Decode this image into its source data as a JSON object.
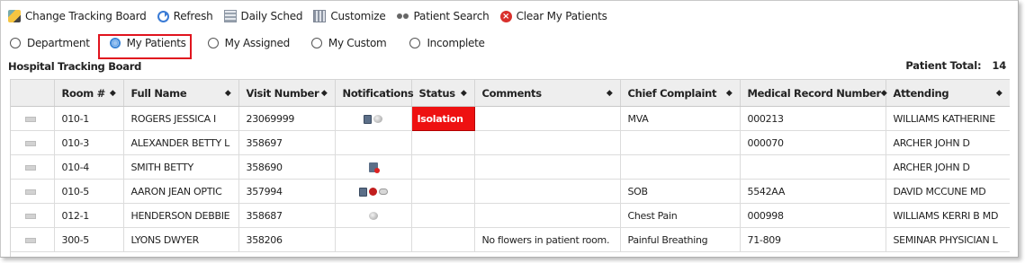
{
  "toolbar": {
    "items": [
      {
        "label": "Change Tracking Board",
        "icon": "pencil-icon"
      },
      {
        "label": "Refresh",
        "icon": "refresh-icon"
      },
      {
        "label": "Daily Sched",
        "icon": "calendar-icon"
      },
      {
        "label": "Customize",
        "icon": "columns-icon"
      },
      {
        "label": "Patient Search",
        "icon": "binoculars-icon"
      },
      {
        "label": "Clear My Patients",
        "icon": "clear-icon"
      }
    ]
  },
  "filters": {
    "options": [
      "Department",
      "My Patients",
      "My Assigned",
      "My Custom",
      "Incomplete"
    ],
    "selected": "My Patients",
    "highlight_color": "#e0141e"
  },
  "board": {
    "title": "Hospital Tracking Board",
    "total_label": "Patient Total:",
    "total_value": "14"
  },
  "table": {
    "columns": [
      "",
      "Room #",
      "Full Name",
      "Visit Number",
      "Notifications",
      "Status",
      "Comments",
      "Chief Complaint",
      "Medical Record Number",
      "Attending"
    ],
    "rows": [
      {
        "room": "010-1",
        "name": "ROGERS JESSICA I",
        "visit": "23069999",
        "notifications": [
          "doc-icon",
          "pill-icon"
        ],
        "status": "Isolation",
        "comments": "",
        "complaint": "MVA",
        "mrn": "000213",
        "attending": "WILLIAMS KATHERINE"
      },
      {
        "room": "010-3",
        "name": "ALEXANDER BETTY L",
        "visit": "358697",
        "notifications": [],
        "status": "",
        "comments": "",
        "complaint": "",
        "mrn": "000070",
        "attending": "ARCHER JOHN D"
      },
      {
        "room": "010-4",
        "name": "SMITH BETTY",
        "visit": "358690",
        "notifications": [
          "flag-alert-icon"
        ],
        "status": "",
        "comments": "",
        "complaint": "",
        "mrn": "",
        "attending": "ARCHER JOHN D"
      },
      {
        "room": "010-5",
        "name": "AARON JEAN OPTIC",
        "visit": "357994",
        "notifications": [
          "doc-icon",
          "alert-icon",
          "cloud-icon"
        ],
        "status": "",
        "comments": "",
        "complaint": "SOB",
        "mrn": "5542AA",
        "attending": "DAVID MCCUNE MD"
      },
      {
        "room": "012-1",
        "name": "HENDERSON DEBBIE",
        "visit": "358687",
        "notifications": [
          "pill-icon"
        ],
        "status": "",
        "comments": "",
        "complaint": "Chest Pain",
        "mrn": "000998",
        "attending": "WILLIAMS KERRI B MD"
      },
      {
        "room": "300-5",
        "name": "LYONS DWYER",
        "visit": "358206",
        "notifications": [],
        "status": "",
        "comments": "No flowers in patient room.",
        "complaint": "Painful Breathing",
        "mrn": "71-809",
        "attending": "SEMINAR PHYSICIAN L"
      }
    ],
    "status_colors": {
      "Isolation": "#ee1111"
    }
  }
}
